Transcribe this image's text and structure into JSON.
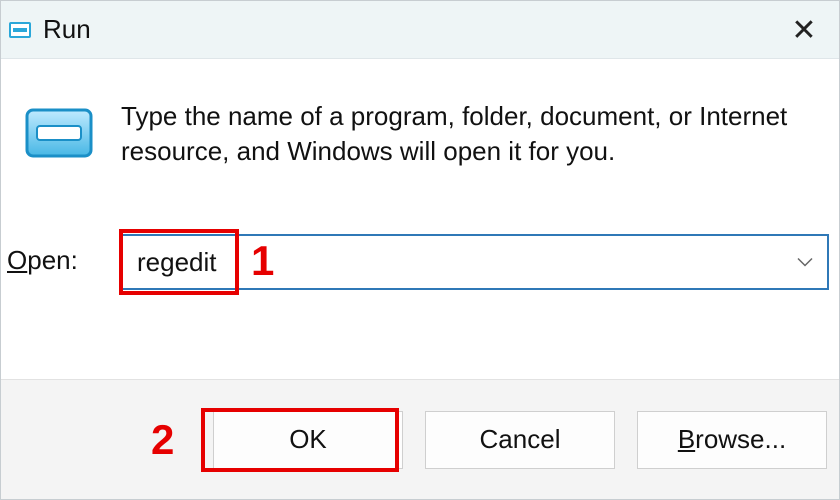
{
  "titlebar": {
    "title": "Run",
    "close_glyph": "✕"
  },
  "body": {
    "description": "Type the name of a program, folder, document, or Internet resource, and Windows will open it for you.",
    "open_label_prefix": "O",
    "open_label_rest": "pen:",
    "input_value": "regedit"
  },
  "buttons": {
    "ok": "OK",
    "cancel": "Cancel",
    "browse_prefix": "B",
    "browse_rest": "rowse..."
  },
  "annotations": {
    "n1": "1",
    "n2": "2"
  }
}
